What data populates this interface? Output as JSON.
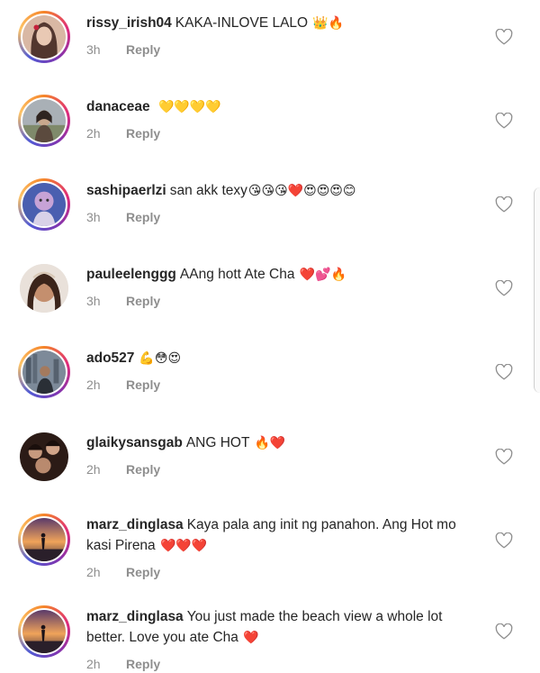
{
  "comments": [
    {
      "user": "rissy_irish04",
      "text": "KAKA-INLOVE LALO",
      "emoji": "👑🔥",
      "time": "3h",
      "reply": "Reply",
      "avatar_colors": [
        "#3a1f1a",
        "#e9c9b4"
      ],
      "ring": true
    },
    {
      "user": "danaceae",
      "text": "",
      "emoji": "💛💛💛💛",
      "time": "2h",
      "reply": "Reply",
      "avatar_colors": [
        "#a9b0b6",
        "#5b4a3e"
      ],
      "ring": true
    },
    {
      "user": "sashipaerlzi",
      "text": "san akk texy",
      "emoji": "😘😘😘❤️😍😍😍😊",
      "time": "3h",
      "reply": "Reply",
      "avatar_colors": [
        "#4a5fb0",
        "#c7a3d6"
      ],
      "ring": true
    },
    {
      "user": "pauleelenggg",
      "text": "AAng hott Ate Cha",
      "emoji": "❤️💕🔥",
      "time": "3h",
      "reply": "Reply",
      "avatar_colors": [
        "#6a3f2c",
        "#e2b9a0"
      ],
      "ring": false
    },
    {
      "user": "ado527",
      "text": "",
      "emoji": "💪😳😍",
      "time": "2h",
      "reply": "Reply",
      "avatar_colors": [
        "#7d8a99",
        "#2a2f36"
      ],
      "ring": true
    },
    {
      "user": "glaikysansgab",
      "text": "ANG HOT",
      "emoji": "🔥❤️",
      "time": "2h",
      "reply": "Reply",
      "avatar_colors": [
        "#2b1b16",
        "#c79a7e"
      ],
      "ring": false
    },
    {
      "user": "marz_dinglasa",
      "text": "Kaya pala ang init ng panahon. Ang Hot mo kasi Pirena",
      "emoji": "❤️❤️❤️",
      "time": "2h",
      "reply": "Reply",
      "avatar_colors": [
        "#f0a35a",
        "#5a3a6a"
      ],
      "ring": true
    },
    {
      "user": "marz_dinglasa",
      "text": "You just made the beach view a whole lot better. Love you ate Cha",
      "emoji": "❤️",
      "time": "2h",
      "reply": "Reply",
      "avatar_colors": [
        "#f0a35a",
        "#5a3a6a"
      ],
      "ring": true
    }
  ],
  "colors": {
    "username": "#262626",
    "meta": "#8e8e8e",
    "heart_outline": "#8e8e8e",
    "background": "#ffffff"
  },
  "icons": {
    "like": "heart-outline-icon"
  }
}
